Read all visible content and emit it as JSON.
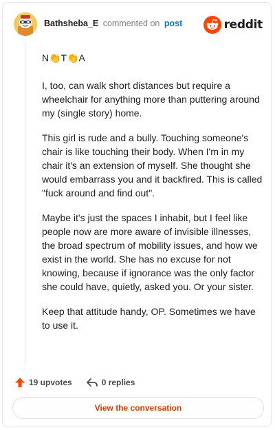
{
  "header": {
    "author": "Bathsheba_E",
    "action": "commented on",
    "post_link": "post",
    "brand": "reddit",
    "avatar_icon": "snoo-avatar-icon",
    "brand_icon": "reddit-logo-icon"
  },
  "comment": {
    "paragraphs": [
      "N👏T👏A",
      "I, too, can walk short distances but require a wheelchair for anything more than puttering around my (single story) home.",
      "This girl is rude and a bully. Touching someone's chair is like touching their body. When I'm in my chair it's an extension of myself. She thought she would embarrass you and it backfired. This is called \"fuck around and find out\".",
      "Maybe it's just the spaces I inhabit, but I feel like people now are more aware of invisible illnesses, the broad spectrum of mobility issues, and how we exist in the world. She has no excuse for not knowing, because if ignorance was the only factor she could have, quietly, asked you. Or your sister.",
      "Keep that attitude handy, OP. Sometimes we have to use it."
    ]
  },
  "footer": {
    "upvotes": "19 upvotes",
    "replies": "0 replies",
    "upvote_icon": "upvote-arrow-icon",
    "reply_icon": "reply-arrow-icon"
  },
  "cta": {
    "label": "View the conversation"
  },
  "colors": {
    "accent": "#d93a00",
    "upvote": "#ff4500",
    "link": "#0079d3"
  }
}
